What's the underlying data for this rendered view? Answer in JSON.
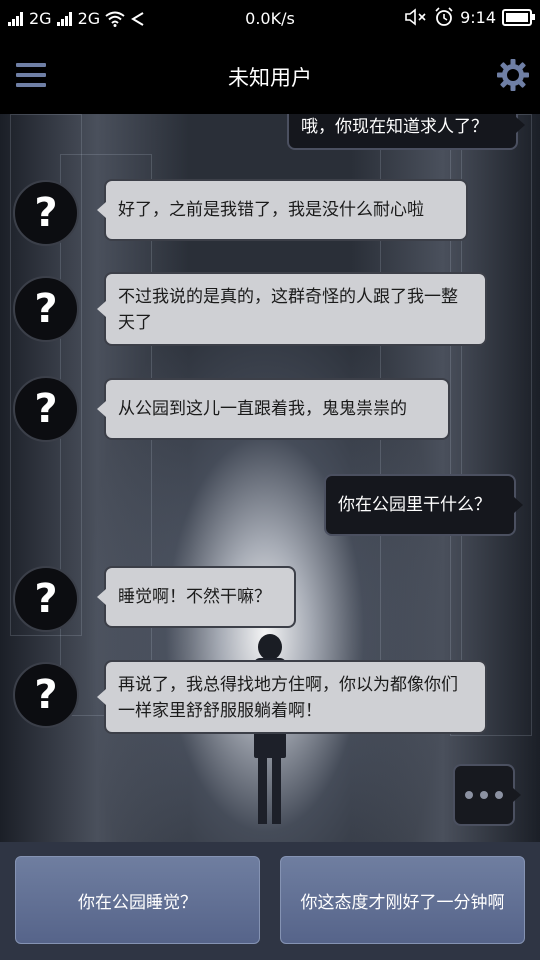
{
  "status_bar": {
    "signal1": "2G",
    "signal2": "2G",
    "speed": "0.0K/s",
    "time": "9:14"
  },
  "header": {
    "title": "未知用户"
  },
  "messages": [
    {
      "side": "out",
      "text": "哦，你现在知道求人了？"
    },
    {
      "side": "in",
      "text": "好了，之前是我错了，我是没什么耐心啦"
    },
    {
      "side": "in",
      "text": "不过我说的是真的，这群奇怪的人跟了我一整天了"
    },
    {
      "side": "in",
      "text": "从公园到这儿一直跟着我，鬼鬼祟祟的"
    },
    {
      "side": "out",
      "text": "你在公园里干什么？"
    },
    {
      "side": "in",
      "text": "睡觉啊！不然干嘛？"
    },
    {
      "side": "in",
      "text": "再说了，我总得找地方住啊，你以为都像你们一样家里舒舒服服躺着啊！"
    }
  ],
  "avatar_glyph": "?",
  "options": [
    {
      "label": "你在公园睡觉？"
    },
    {
      "label": "你这态度才刚好了一分钟啊"
    }
  ],
  "colors": {
    "accent": "#6f7fa5",
    "option_button": "#5f6d92",
    "bubble_in": "#cfd0d4",
    "bubble_out": "#15171d"
  }
}
